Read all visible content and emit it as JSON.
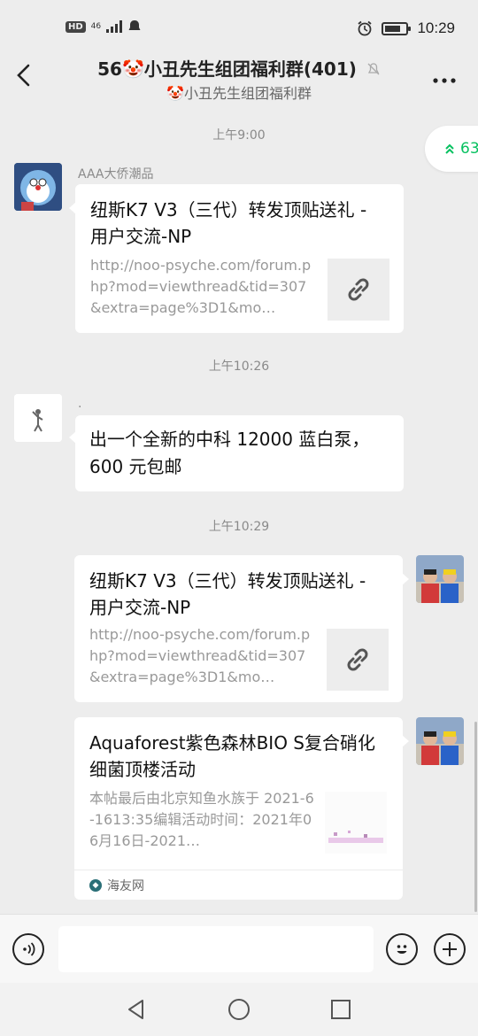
{
  "status_bar": {
    "left_badge": "HD",
    "network": "46",
    "time": "10:29",
    "battery_level": 0.75
  },
  "header": {
    "title": "56🤡小丑先生组团福利群(401)",
    "subtitle": "🤡小丑先生组团福利群",
    "back_icon": "chevron-left-icon",
    "mute_icon": "bell-off-icon",
    "more_icon": "more-dots-icon"
  },
  "unread_pill": {
    "text": "63"
  },
  "messages": {
    "ts1": "上午9:00",
    "m1": {
      "sender": "AAA大侨潮品",
      "title": "纽斯K7 V3（三代）转发顶贴送礼 - 用户交流-NP",
      "desc": "http://noo-psyche.com/forum.php?mod=viewthread&tid=307&extra=page%3D1&mo…"
    },
    "ts2": "上午10:26",
    "m2": {
      "sender": ".",
      "text": "出一个全新的中科 12000 蓝白泵，600 元包邮"
    },
    "ts3": "上午10:29",
    "m3": {
      "title": "纽斯K7 V3（三代）转发顶贴送礼 - 用户交流-NP",
      "desc": "http://noo-psyche.com/forum.php?mod=viewthread&tid=307&extra=page%3D1&mo…"
    },
    "m4": {
      "title": "Aquaforest紫色森林BIO S复合硝化细菌顶楼活动",
      "desc": "本帖最后由北京知鱼水族于 2021-6-1613:35编辑活动时间：2021年06月16日-2021…",
      "source": "海友网"
    }
  },
  "input_bar": {
    "voice_icon": "voice-icon",
    "emoji_icon": "emoji-icon",
    "plus_icon": "plus-icon",
    "placeholder": ""
  },
  "nav_bar": {
    "back_icon": "triangle-back-icon",
    "home_icon": "circle-home-icon",
    "recents_icon": "square-recents-icon"
  }
}
